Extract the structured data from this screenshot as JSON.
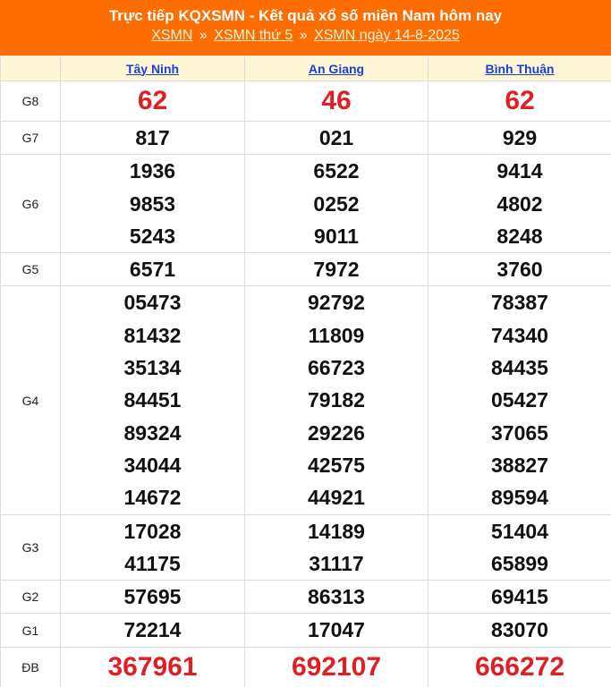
{
  "header": {
    "title": "Trực tiếp KQXSMN - Kết quả xổ số miền Nam hôm nay",
    "crumbs": [
      "XSMN",
      "XSMN thứ 5",
      "XSMN ngày 14-8-2025"
    ],
    "separator": "»"
  },
  "columns": [
    "Tây Ninh",
    "An Giang",
    "Bình Thuận"
  ],
  "prizes": [
    {
      "label": "G8",
      "values": [
        [
          "62"
        ],
        [
          "46"
        ],
        [
          "62"
        ]
      ]
    },
    {
      "label": "G7",
      "values": [
        [
          "817"
        ],
        [
          "021"
        ],
        [
          "929"
        ]
      ]
    },
    {
      "label": "G6",
      "values": [
        [
          "1936",
          "9853",
          "5243"
        ],
        [
          "6522",
          "0252",
          "9011"
        ],
        [
          "9414",
          "4802",
          "8248"
        ]
      ]
    },
    {
      "label": "G5",
      "values": [
        [
          "6571"
        ],
        [
          "7972"
        ],
        [
          "3760"
        ]
      ]
    },
    {
      "label": "G4",
      "values": [
        [
          "05473",
          "81432",
          "35134",
          "84451",
          "89324",
          "34044",
          "14672"
        ],
        [
          "92792",
          "11809",
          "66723",
          "79182",
          "29226",
          "42575",
          "44921"
        ],
        [
          "78387",
          "74340",
          "84435",
          "05427",
          "37065",
          "38827",
          "89594"
        ]
      ]
    },
    {
      "label": "G3",
      "values": [
        [
          "17028",
          "41175"
        ],
        [
          "14189",
          "31117"
        ],
        [
          "51404",
          "65899"
        ]
      ]
    },
    {
      "label": "G2",
      "values": [
        [
          "57695"
        ],
        [
          "86313"
        ],
        [
          "69415"
        ]
      ]
    },
    {
      "label": "G1",
      "values": [
        [
          "72214"
        ],
        [
          "17047"
        ],
        [
          "83070"
        ]
      ]
    },
    {
      "label": "ĐB",
      "values": [
        [
          "367961"
        ],
        [
          "692107"
        ],
        [
          "666272"
        ]
      ]
    }
  ],
  "colors": {
    "header_bg": "#ff6d00",
    "highlight": "#e01f24",
    "header_row_bg": "#fff6d6",
    "link": "#1a3fd6"
  }
}
